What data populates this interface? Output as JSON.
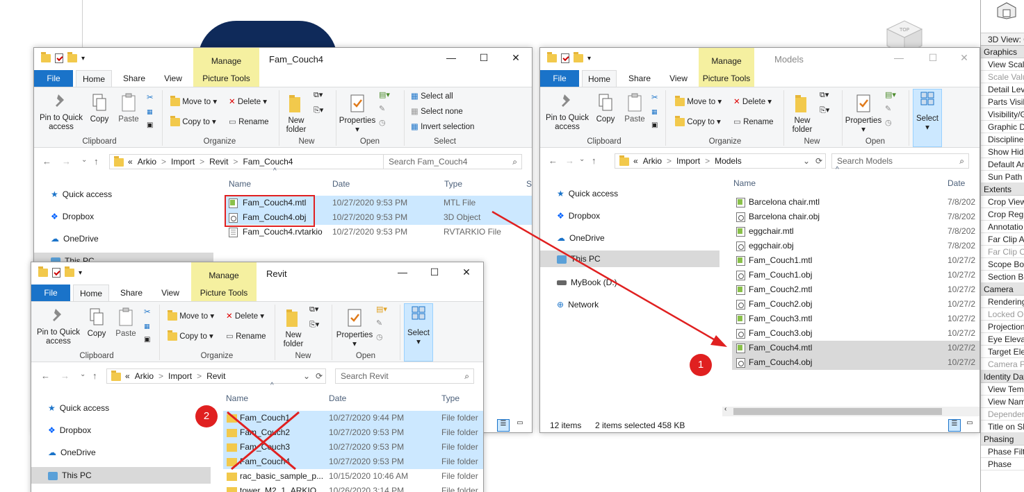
{
  "colors": {
    "accent": "#1a73c9",
    "manage_tab": "#f5f0a0",
    "annotation_red": "#e02020",
    "selection": "#cce8ff"
  },
  "ribbon_labels": {
    "file": "File",
    "home": "Home",
    "share": "Share",
    "view": "View",
    "manage": "Manage",
    "picture_tools": "Picture Tools",
    "pin": "Pin to Quick\naccess",
    "copy": "Copy",
    "paste": "Paste",
    "move_to": "Move to",
    "copy_to": "Copy to",
    "delete": "Delete",
    "rename": "Rename",
    "new_folder": "New\nfolder",
    "properties": "Properties",
    "select_all": "Select all",
    "select_none": "Select none",
    "invert_selection": "Invert selection",
    "select": "Select",
    "grp_clipboard": "Clipboard",
    "grp_organize": "Organize",
    "grp_new": "New",
    "grp_open": "Open",
    "grp_select": "Select"
  },
  "nav_labels": {
    "quick_access": "Quick access",
    "dropbox": "Dropbox",
    "onedrive": "OneDrive",
    "this_pc": "This PC",
    "mybook": "MyBook (D:)",
    "network": "Network"
  },
  "columns": {
    "name": "Name",
    "date": "Date",
    "type": "Type",
    "size": "S"
  },
  "win1": {
    "title": "Fam_Couch4",
    "path": [
      "«",
      "Arkio",
      ">",
      "Import",
      ">",
      "Revit",
      ">",
      "Fam_Couch4"
    ],
    "search": "Search Fam_Couch4",
    "files": [
      {
        "name": "Fam_Couch4.mtl",
        "date": "10/27/2020 9:53 PM",
        "type": "MTL File"
      },
      {
        "name": "Fam_Couch4.obj",
        "date": "10/27/2020 9:53 PM",
        "type": "3D Object"
      },
      {
        "name": "Fam_Couch4.rvtarkio",
        "date": "10/27/2020 9:53 PM",
        "type": "RVTARKIO File"
      }
    ]
  },
  "win2": {
    "title": "Models",
    "path": [
      "«",
      "Arkio",
      ">",
      "Import",
      ">",
      "Models"
    ],
    "search": "Search Models",
    "files": [
      {
        "name": "Barcelona chair.mtl",
        "date": "7/8/202"
      },
      {
        "name": "Barcelona chair.obj",
        "date": "7/8/202"
      },
      {
        "name": "eggchair.mtl",
        "date": "7/8/202"
      },
      {
        "name": "eggchair.obj",
        "date": "7/8/202"
      },
      {
        "name": "Fam_Couch1.mtl",
        "date": "10/27/2"
      },
      {
        "name": "Fam_Couch1.obj",
        "date": "10/27/2"
      },
      {
        "name": "Fam_Couch2.mtl",
        "date": "10/27/2"
      },
      {
        "name": "Fam_Couch2.obj",
        "date": "10/27/2"
      },
      {
        "name": "Fam_Couch3.mtl",
        "date": "10/27/2"
      },
      {
        "name": "Fam_Couch3.obj",
        "date": "10/27/2"
      },
      {
        "name": "Fam_Couch4.mtl",
        "date": "10/27/2"
      },
      {
        "name": "Fam_Couch4.obj",
        "date": "10/27/2"
      }
    ],
    "status_items": "12 items",
    "status_selected": "2 items selected  458 KB"
  },
  "win3": {
    "title": "Revit",
    "path": [
      "«",
      "Arkio",
      ">",
      "Import",
      ">",
      "Revit"
    ],
    "search": "Search Revit",
    "files": [
      {
        "name": "Fam_Couch1",
        "date": "10/27/2020 9:44 PM",
        "type": "File folder"
      },
      {
        "name": "Fam_Couch2",
        "date": "10/27/2020 9:53 PM",
        "type": "File folder"
      },
      {
        "name": "Fam_Couch3",
        "date": "10/27/2020 9:53 PM",
        "type": "File folder"
      },
      {
        "name": "Fam_Couch4",
        "date": "10/27/2020 9:53 PM",
        "type": "File folder"
      },
      {
        "name": "rac_basic_sample_p...",
        "date": "10/15/2020 10:46 AM",
        "type": "File folder"
      },
      {
        "name": "tower_M2_1_ARKIO",
        "date": "10/26/2020 3:14 PM",
        "type": "File folder"
      }
    ]
  },
  "annotations": {
    "step1": "1",
    "step2": "2"
  },
  "properties_panel": {
    "top_label": "3D View: C",
    "rows": [
      {
        "t": "h",
        "v": "Graphics"
      },
      {
        "t": "r",
        "v": "View Scale"
      },
      {
        "t": "g",
        "v": "Scale Valu"
      },
      {
        "t": "r",
        "v": "Detail Leve"
      },
      {
        "t": "r",
        "v": "Parts Visib"
      },
      {
        "t": "r",
        "v": "Visibility/G"
      },
      {
        "t": "r",
        "v": "Graphic Di"
      },
      {
        "t": "r",
        "v": "Discipline"
      },
      {
        "t": "r",
        "v": "Show Hidd"
      },
      {
        "t": "r",
        "v": "Default An"
      },
      {
        "t": "r",
        "v": "Sun Path"
      },
      {
        "t": "h",
        "v": "Extents"
      },
      {
        "t": "r",
        "v": "Crop View"
      },
      {
        "t": "r",
        "v": "Crop Regio"
      },
      {
        "t": "r",
        "v": "Annotatio"
      },
      {
        "t": "r",
        "v": "Far Clip A"
      },
      {
        "t": "g",
        "v": "Far Clip O"
      },
      {
        "t": "r",
        "v": "Scope Box"
      },
      {
        "t": "r",
        "v": "Section Bo"
      },
      {
        "t": "h",
        "v": "Camera"
      },
      {
        "t": "r",
        "v": "Rendering"
      },
      {
        "t": "g",
        "v": "Locked Or"
      },
      {
        "t": "r",
        "v": "Projection"
      },
      {
        "t": "r",
        "v": "Eye Elevat"
      },
      {
        "t": "r",
        "v": "Target Ele"
      },
      {
        "t": "g",
        "v": "Camera Po"
      },
      {
        "t": "h",
        "v": "Identity Dat"
      },
      {
        "t": "r",
        "v": "View Temp"
      },
      {
        "t": "r",
        "v": "View Name"
      },
      {
        "t": "g",
        "v": "Dependen"
      },
      {
        "t": "r",
        "v": "Title on Sh"
      },
      {
        "t": "h",
        "v": "Phasing"
      },
      {
        "t": "r",
        "v": "Phase Filte"
      },
      {
        "t": "r",
        "v": "Phase"
      }
    ]
  }
}
